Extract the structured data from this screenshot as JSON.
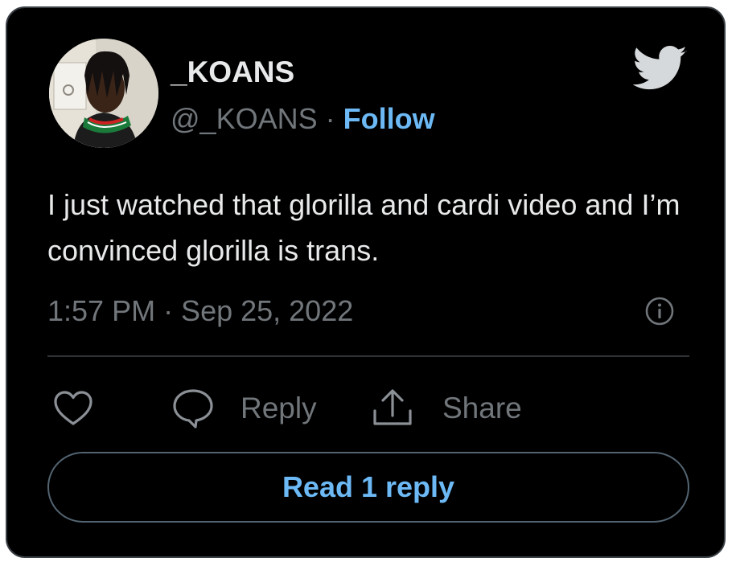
{
  "author": {
    "display_name": "_KOANS",
    "handle": "@_KOANS",
    "separator": " · ",
    "follow_label": "Follow"
  },
  "tweet": {
    "text": "I just watched that glorilla and cardi video and I’m convinced glorilla is trans.",
    "timestamp": "1:57 PM · Sep 25, 2022"
  },
  "actions": {
    "like_icon": "heart-icon",
    "reply_icon": "speech-bubble-icon",
    "reply_label": "Reply",
    "share_icon": "upload-arrow-icon",
    "share_label": "Share"
  },
  "read_replies_label": "Read 1 reply",
  "icons": {
    "brand": "twitter-bird-icon",
    "info": "info-circle-icon"
  },
  "colors": {
    "background": "#000000",
    "primary_text": "#e7e9ea",
    "secondary_text": "#71767b",
    "link": "#6cb9f5",
    "border": "#3a3f45",
    "button_border": "#536471"
  }
}
